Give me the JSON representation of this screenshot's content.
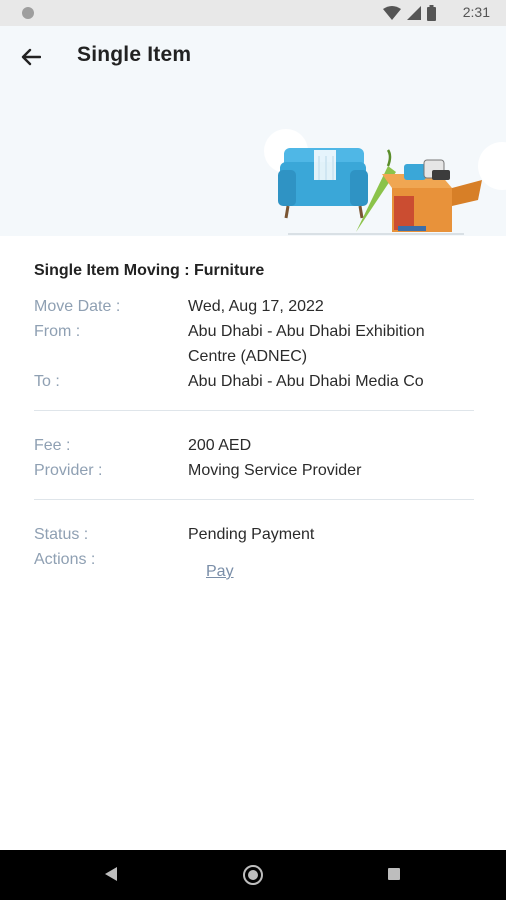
{
  "status_bar": {
    "time": "2:31"
  },
  "header": {
    "title": "Single Item"
  },
  "details": {
    "title": "Single Item Moving : Furniture",
    "move_date_label": "Move Date :",
    "move_date": "Wed, Aug 17, 2022",
    "from_label": "From :",
    "from_line1": "Abu Dhabi - Abu Dhabi Exhibition",
    "from_line2": "Centre (ADNEC)",
    "to_label": "To :",
    "to": "Abu Dhabi - Abu Dhabi Media Co"
  },
  "payment": {
    "fee_label": "Fee :",
    "fee": "200 AED",
    "provider_label": "Provider :",
    "provider": "Moving Service Provider"
  },
  "status": {
    "status_label": "Status :",
    "status": "Pending Payment",
    "actions_label": "Actions :",
    "pay_label": "Pay"
  },
  "colors": {
    "label": "#8fa0b3",
    "link": "#7a8ea8",
    "header_bg": "#f4f8fb",
    "sofa": "#3aa7d8",
    "box": "#e8923a"
  },
  "icons": [
    "back-arrow-icon",
    "wifi-icon",
    "signal-icon",
    "battery-icon",
    "nav-back-icon",
    "nav-home-icon",
    "nav-recents-icon"
  ]
}
